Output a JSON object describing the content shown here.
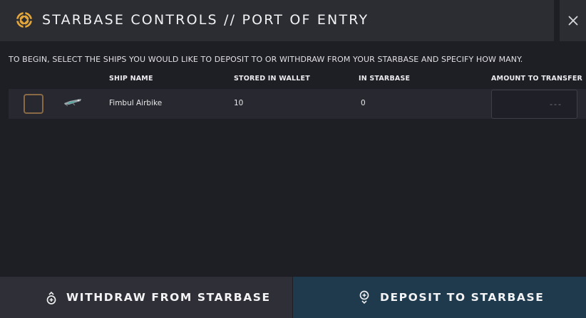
{
  "header": {
    "title": "STARBASE CONTROLS // PORT OF ENTRY",
    "logo_icon": "starbase-emblem-icon",
    "accent_color": "#e3a63a",
    "close_icon": "close-icon"
  },
  "instructions": "TO BEGIN, SELECT THE SHIPS YOU WOULD LIKE TO DEPOSIT TO OR WITHDRAW FROM YOUR STARBASE AND SPECIFY HOW MANY.",
  "table": {
    "columns": [
      "SHIP NAME",
      "STORED IN WALLET",
      "IN STARBASE",
      "AMOUNT TO TRANSFER"
    ],
    "rows": [
      {
        "selected": false,
        "ship_icon": "airbike-ship-icon",
        "ship_name": "Fimbul Airbike",
        "stored_in_wallet": "10",
        "in_starbase": "0",
        "amount_placeholder": "---"
      }
    ]
  },
  "footer": {
    "withdraw_label": "WITHDRAW FROM STARBASE",
    "withdraw_icon": "withdraw-icon",
    "deposit_label": "DEPOSIT TO STARBASE",
    "deposit_icon": "deposit-icon",
    "deposit_color": "#1e3a4c"
  }
}
